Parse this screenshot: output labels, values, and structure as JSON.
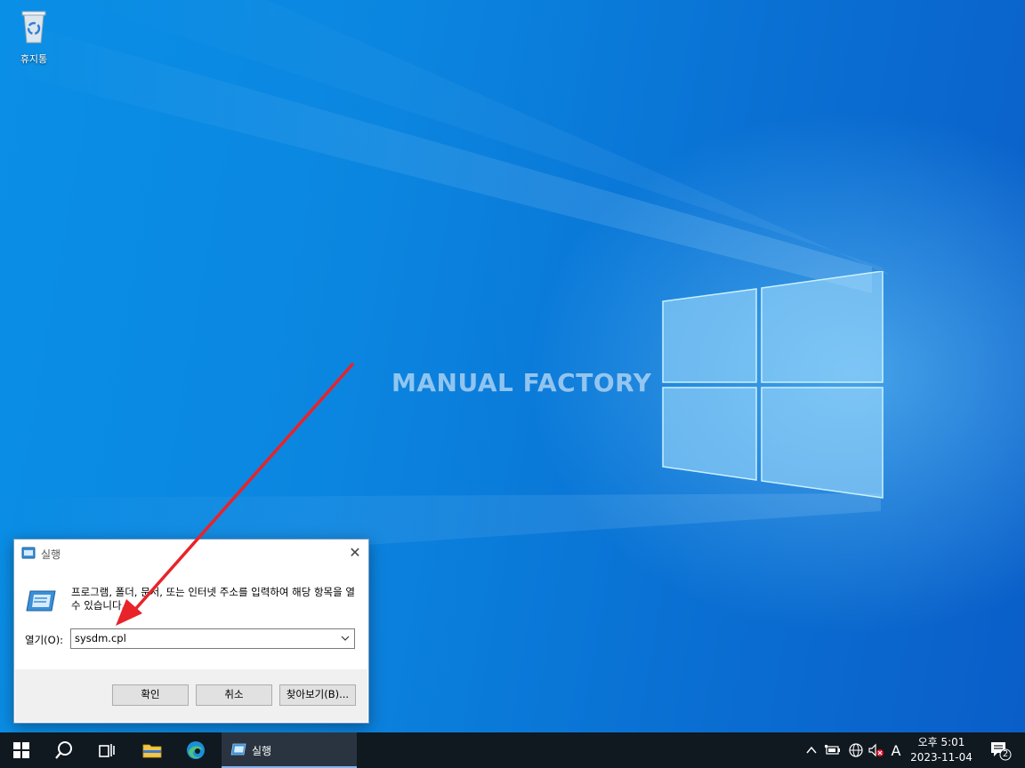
{
  "desktop": {
    "icons": [
      {
        "label": "휴지통",
        "icon": "recycle-bin-icon"
      }
    ],
    "watermark": "MANUAL FACTORY"
  },
  "run_dialog": {
    "title": "실행",
    "description": "프로그램, 폴더, 문서, 또는 인터넷 주소를 입력하여 해당 항목을 열 수 있습니다.",
    "open_label": "열기(O):",
    "open_value": "sysdm.cpl",
    "buttons": {
      "ok": "확인",
      "cancel": "취소",
      "browse": "찾아보기(B)..."
    }
  },
  "annotation": {
    "arrow_color": "#e8232a"
  },
  "taskbar": {
    "running_app_label": "실행",
    "ime_indicator": "A",
    "clock": {
      "time": "오후 5:01",
      "date": "2023-11-04"
    },
    "notification_count": "2"
  },
  "colors": {
    "accent": "#0a8fe6",
    "taskbar": "#101820"
  }
}
